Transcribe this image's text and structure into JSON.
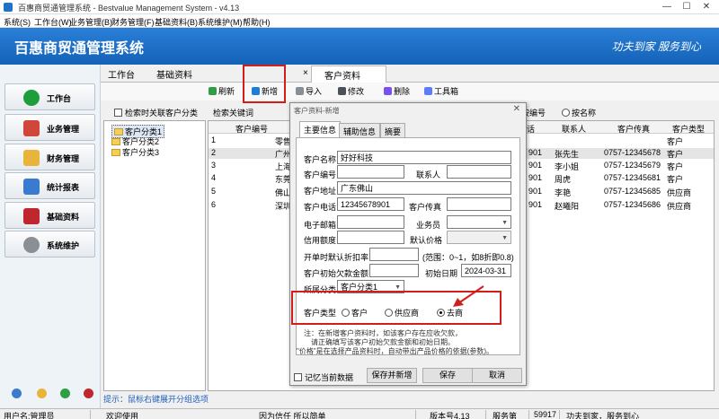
{
  "window": {
    "title": "百惠商贸通管理系统 - Bestvalue Management System - v4.13",
    "min": "—",
    "max": "☐",
    "close": "✕"
  },
  "menu": [
    {
      "label": "系统(S)"
    },
    {
      "label": "工作台(W)"
    },
    {
      "label": "业务管理(B)"
    },
    {
      "label": "财务管理(F)"
    },
    {
      "label": "基础资料(B)"
    },
    {
      "label": "系统维护(M)"
    },
    {
      "label": "帮助(H)"
    }
  ],
  "banner": {
    "title": "百惠商贸通管理系统",
    "slogan": "功夫到家 服务到心"
  },
  "sidebar": [
    {
      "label": "工作台",
      "color": "#1e9e3a"
    },
    {
      "label": "业务管理",
      "color": "#d0463b"
    },
    {
      "label": "财务管理",
      "color": "#e8b53a"
    },
    {
      "label": "统计报表",
      "color": "#3a7bd0"
    },
    {
      "label": "基础资料",
      "color": "#c0262d"
    },
    {
      "label": "系统维护",
      "color": "#8a8f96"
    }
  ],
  "tabs": [
    {
      "label": "工作台"
    },
    {
      "label": "基础资料"
    },
    {
      "label": "客户资料"
    }
  ],
  "tab_close": "×",
  "toolbar": [
    {
      "label": "刷新",
      "color": "#2f9e44"
    },
    {
      "label": "新增",
      "color": "#1c7ed6"
    },
    {
      "label": "导入",
      "color": "#868e96"
    },
    {
      "label": "修改",
      "color": "#495057"
    },
    {
      "label": "删除",
      "color": "#7950f2"
    },
    {
      "label": "工具箱",
      "color": "#5c7cfa"
    }
  ],
  "filter": {
    "checkbox_label": "检索时关联客户分类",
    "keyword_label": "检索关键词",
    "opt_code": "按编号",
    "opt_name": "按名称"
  },
  "tree": [
    {
      "label": "客户分类1"
    },
    {
      "label": "客户分类2"
    },
    {
      "label": "客户分类3"
    }
  ],
  "hint": "提示：鼠标右键展开分组选项",
  "grid": {
    "headers": {
      "code": "客户编号",
      "fax": "客户传真",
      "type": "客户类型",
      "contact": "联系人",
      "phone_tail": "话"
    },
    "rows": [
      {
        "no": "1",
        "code": "零售",
        "phone": "",
        "contact": "",
        "fax": "",
        "type": "客户"
      },
      {
        "no": "2",
        "code": "广州",
        "phone": "901",
        "contact": "张先生",
        "fax": "0757-12345678",
        "type": "客户"
      },
      {
        "no": "3",
        "code": "上海",
        "phone": "901",
        "contact": "李小姐",
        "fax": "0757-12345679",
        "type": "客户"
      },
      {
        "no": "4",
        "code": "东莞",
        "phone": "901",
        "contact": "周虎",
        "fax": "0757-12345681",
        "type": "客户"
      },
      {
        "no": "5",
        "code": "佛山",
        "phone": "901",
        "contact": "李艳",
        "fax": "0757-12345685",
        "type": "供应商"
      },
      {
        "no": "6",
        "code": "深圳",
        "phone": "901",
        "contact": "赵曦阳",
        "fax": "0757-12345686",
        "type": "供应商"
      }
    ]
  },
  "dialog": {
    "title": "客户资料-新增",
    "close": "✕",
    "tabs": [
      {
        "label": "主要信息"
      },
      {
        "label": "辅助信息"
      },
      {
        "label": "摘要"
      }
    ],
    "fields": {
      "name_label": "客户名称",
      "name_value": "好好科技",
      "code_label": "客户编号",
      "code_value": "",
      "contact_label": "联系人",
      "contact_value": "",
      "addr_label": "客户地址",
      "addr_value": "广东佛山",
      "phone_label": "客户电话",
      "phone_value": "12345678901",
      "fax_label": "客户传真",
      "fax_value": "",
      "email_label": "电子邮箱",
      "email_value": "",
      "sales_label": "业务员",
      "sales_value": "",
      "credit_label": "信用额度",
      "credit_value": "",
      "price_label": "默认价格",
      "price_value": "",
      "discount_label": "开单时默认折扣率",
      "discount_value": "",
      "discount_hint": "(范围：0~1，如8折即0.8)",
      "debt_label": "客户初始欠款金额",
      "debt_value": "",
      "date_label": "初始日期",
      "date_value": "2024-03-31",
      "category_label": "所属分类",
      "category_value": "客户分类1"
    },
    "type": {
      "label": "客户类型",
      "options": [
        {
          "label": "客户"
        },
        {
          "label": "供应商"
        },
        {
          "label": "去商"
        }
      ],
      "selected": 2
    },
    "note": [
      "注：在新增客户资料时，如该客户存在应收欠款，",
      "请正确填写该客户初始欠款金额和初始日期。",
      "\"价格\"是在选择产品资料时，自动带出产品价格的依据(参数)。"
    ],
    "remember_label": "记忆当前数据",
    "buttons": {
      "save_new": "保存并新增",
      "save": "保存",
      "cancel": "取消"
    }
  },
  "status": {
    "user": "用户名:管理员",
    "welcome": "欢迎使用",
    "motto": "因为信任 所以简单",
    "version": "版本号4.13",
    "service": "服务第",
    "count": "59917",
    "slogan": "功夫到家，服务到心"
  },
  "colors": {
    "accent": "#1e73c8",
    "highlight": "#d21d1d"
  }
}
